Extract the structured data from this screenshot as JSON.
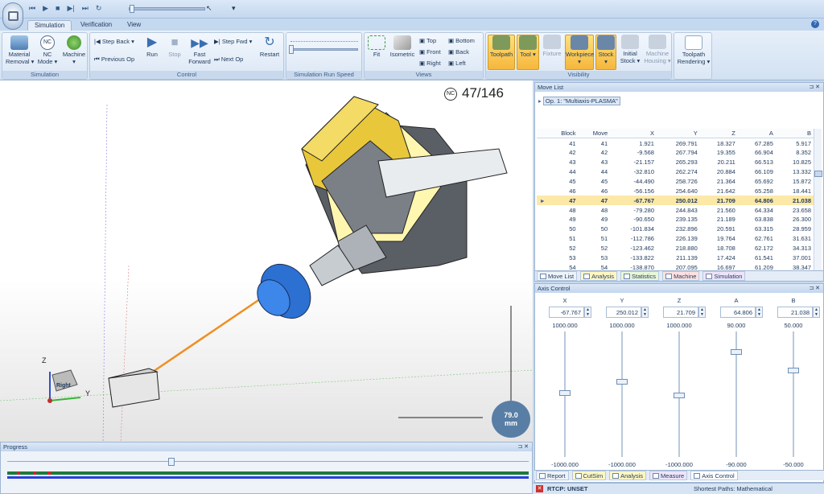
{
  "qat": {
    "icons": [
      "skip-start-icon",
      "play-icon",
      "stop-icon",
      "step-forward-icon",
      "skip-end-icon",
      "loop-icon"
    ],
    "more": "▾"
  },
  "tabs": [
    "Simulation",
    "Verification",
    "View"
  ],
  "ribbon": {
    "material_removal": "Material\nRemoval ▾",
    "nc_mode": "NC\nMode ▾",
    "machine": "Machine\n▾",
    "sim_group": "Simulation",
    "step_back": "Step Back ▾",
    "previous_op": "Previous Op",
    "run": "Run",
    "stop": "Stop",
    "fast_forward": "Fast\nForward",
    "step_fwd": "Step Fwd ▾",
    "next_op": "Next Op",
    "restart": "Restart",
    "control_group": "Control",
    "speed_group": "Simulation Run Speed",
    "fit": "Fit",
    "isometric": "Isometric",
    "top": "Top",
    "front": "Front",
    "right": "Right",
    "bottom": "Bottom",
    "back": "Back",
    "left": "Left",
    "views_group": "Views",
    "toolpath": "Toolpath",
    "tool": "Tool ▾",
    "fixture": "Fixture",
    "workpiece": "Workpiece ▾",
    "stock": "Stock ▾",
    "initial_stock": "Initial\nStock ▾",
    "machine_housing": "Machine\nHousing ▾",
    "visibility_group": "Visibility",
    "toolpath_rendering": "Toolpath\nRendering ▾"
  },
  "viewport": {
    "nc_label": "NC",
    "counter": "47/146",
    "distance_value": "79.0",
    "distance_unit": "mm",
    "axis_z": "Z",
    "axis_y": "Y",
    "cube_label": "Right"
  },
  "progress": {
    "title": "Progress"
  },
  "move_list": {
    "title": "Move List",
    "operation": "Op. 1: \"Multiaxis-PLASMA\"",
    "columns": [
      "Block",
      "Move",
      "X",
      "Y",
      "Z",
      "A",
      "B"
    ],
    "rows": [
      [
        "41",
        "41",
        "1.921",
        "269.791",
        "18.327",
        "67.285",
        "5.917"
      ],
      [
        "42",
        "42",
        "-9.568",
        "267.794",
        "19.355",
        "66.904",
        "8.352"
      ],
      [
        "43",
        "43",
        "-21.157",
        "265.293",
        "20.211",
        "66.513",
        "10.825"
      ],
      [
        "44",
        "44",
        "-32.810",
        "262.274",
        "20.884",
        "66.109",
        "13.332"
      ],
      [
        "45",
        "45",
        "-44.490",
        "258.726",
        "21.364",
        "65.692",
        "15.872"
      ],
      [
        "46",
        "46",
        "-56.156",
        "254.640",
        "21.642",
        "65.258",
        "18.441"
      ],
      [
        "47",
        "47",
        "-67.767",
        "250.012",
        "21.709",
        "64.806",
        "21.038"
      ],
      [
        "48",
        "48",
        "-79.280",
        "244.843",
        "21.560",
        "64.334",
        "23.658"
      ],
      [
        "49",
        "49",
        "-90.650",
        "239.135",
        "21.189",
        "63.838",
        "26.300"
      ],
      [
        "50",
        "50",
        "-101.834",
        "232.896",
        "20.591",
        "63.315",
        "28.959"
      ],
      [
        "51",
        "51",
        "-112.786",
        "226.139",
        "19.764",
        "62.761",
        "31.631"
      ],
      [
        "52",
        "52",
        "-123.462",
        "218.880",
        "18.708",
        "62.172",
        "34.313"
      ],
      [
        "53",
        "53",
        "-133.822",
        "211.139",
        "17.424",
        "61.541",
        "37.001"
      ],
      [
        "54",
        "54",
        "-138.870",
        "207.095",
        "16.697",
        "61.209",
        "38.347"
      ]
    ],
    "tabs": [
      "Move List",
      "Analysis",
      "Statistics",
      "Machine",
      "Simulation"
    ]
  },
  "axis_control": {
    "title": "Axis Control",
    "axes": [
      {
        "name": "X",
        "value": "-67.767",
        "max": "1000.000",
        "min": "-1000.000",
        "pos": 0.466
      },
      {
        "name": "Y",
        "value": "250.012",
        "max": "1000.000",
        "min": "-1000.000",
        "pos": 0.375
      },
      {
        "name": "Z",
        "value": "21.709",
        "max": "1000.000",
        "min": "-1000.000",
        "pos": 0.489
      },
      {
        "name": "A",
        "value": "64.806",
        "max": "90.000",
        "min": "-90.000",
        "pos": 0.14
      },
      {
        "name": "B",
        "value": "21.038",
        "max": "50.000",
        "min": "-50.000",
        "pos": 0.29
      }
    ],
    "tabs": [
      "Report",
      "CutSim",
      "Analysis",
      "Measure",
      "Axis Control"
    ]
  },
  "status": {
    "rtcp": "RTCP: UNSET",
    "paths": "Shortest Paths: Mathematical"
  }
}
